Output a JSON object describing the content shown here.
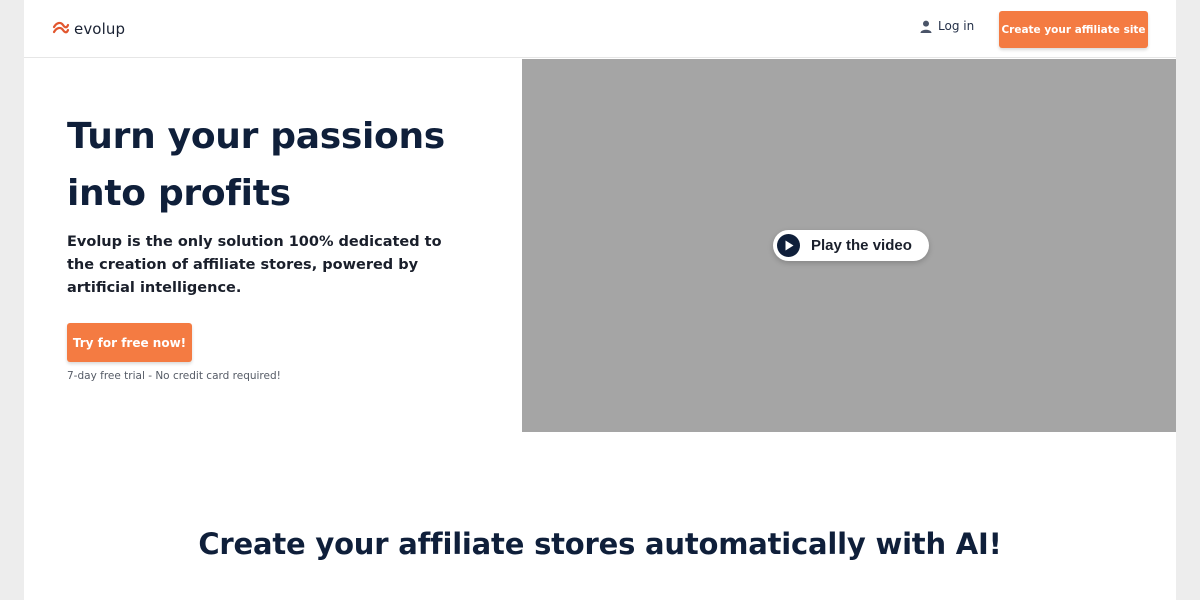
{
  "header": {
    "logo_text": "evolup",
    "login_label": "Log in",
    "create_site_label": "Create your affiliate site"
  },
  "hero": {
    "title": "Turn your passions into profits",
    "description": "Evolup is the only solution 100% dedicated to the creation of affiliate stores, powered by artificial intelligence.",
    "cta_label": "Try for free now!",
    "trial_note": "7-day free trial - No credit card required!"
  },
  "video": {
    "play_label": "Play the video"
  },
  "section": {
    "title": "Create your affiliate stores automatically with AI!"
  },
  "colors": {
    "accent": "#f47b42",
    "navy": "#0f1f3a",
    "video_placeholder": "#a5a5a5"
  },
  "icons": {
    "logo": "evolup-logo-icon",
    "user": "user-icon",
    "play": "play-icon"
  }
}
